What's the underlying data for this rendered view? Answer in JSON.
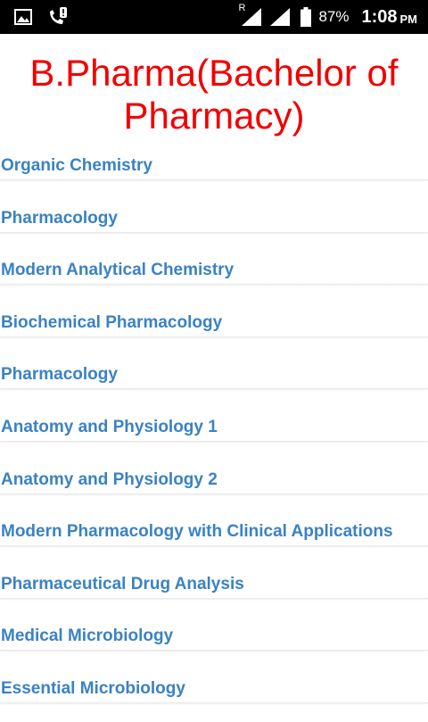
{
  "status_bar": {
    "icons_left": [
      "image-icon",
      "phone-alert-icon"
    ],
    "icons_right": [
      "roaming-signal-icon",
      "signal-icon",
      "battery-icon"
    ],
    "roaming_letter": "R",
    "battery": "87%",
    "time": "1:08",
    "ampm": "PM"
  },
  "title": "B.Pharma(Bachelor of Pharmacy)",
  "subjects": [
    "Organic Chemistry",
    "Pharmacology",
    "Modern Analytical Chemistry",
    "Biochemical Pharmacology",
    "Pharmacology",
    "Anatomy and Physiology 1",
    "Anatomy and Physiology 2",
    "Modern Pharmacology with Clinical Applications",
    "Pharmaceutical Drug Analysis",
    "Medical Microbiology",
    "Essential Microbiology"
  ],
  "colors": {
    "title": "#f20000",
    "item_text": "#3a82c4"
  }
}
